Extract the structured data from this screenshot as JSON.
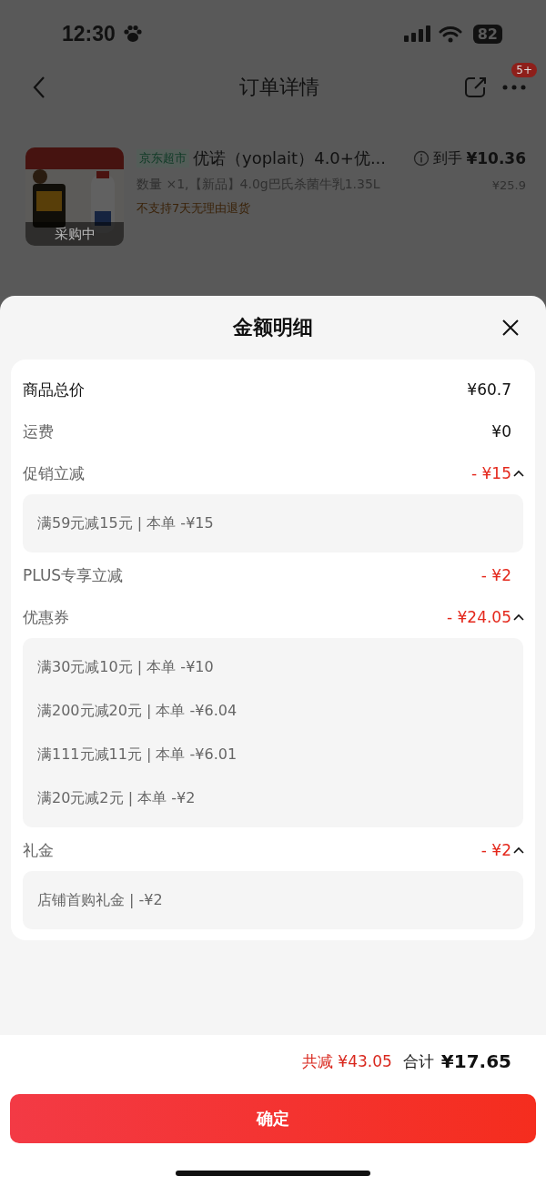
{
  "status_bar": {
    "time": "12:30",
    "battery": "82"
  },
  "nav": {
    "title": "订单详情",
    "badge": "5+"
  },
  "products": [
    {
      "store_tag": "京东超市",
      "name": "优诺（yoplait）4.0+优...",
      "price_label": "到手",
      "price": "¥10.36",
      "spec": "数量 ×1,【新品】4.0g巴氏杀菌牛乳1.35L",
      "original_price": "¥25.9",
      "notice": "不支持7天无理由退货",
      "image_status": "采购中"
    }
  ],
  "sheet": {
    "title": "金额明细",
    "rows": [
      {
        "kind": "total",
        "label": "商品总价",
        "value": "¥60.7"
      },
      {
        "kind": "plain",
        "label": "运费",
        "value": "¥0"
      },
      {
        "kind": "discount",
        "label": "促销立减",
        "value": "- ¥15",
        "expanded": true,
        "details": [
          "满59元减15元 | 本单 -¥15"
        ]
      },
      {
        "kind": "discount",
        "label": "PLUS专享立减",
        "value": "- ¥2"
      },
      {
        "kind": "discount",
        "label": "优惠券",
        "value": "- ¥24.05",
        "expanded": true,
        "details": [
          "满30元减10元 | 本单 -¥10",
          "满200元减20元 | 本单 -¥6.04",
          "满111元减11元 | 本单 -¥6.01",
          "满20元减2元 | 本单 -¥2"
        ]
      },
      {
        "kind": "discount",
        "label": "礼金",
        "value": "- ¥2",
        "expanded": true,
        "details": [
          "店铺首购礼金 | -¥2"
        ]
      }
    ]
  },
  "footer": {
    "saved_label": "共减",
    "saved": "¥43.05",
    "total_label": "合计",
    "total": "¥17.65"
  },
  "confirm_button": "确定"
}
